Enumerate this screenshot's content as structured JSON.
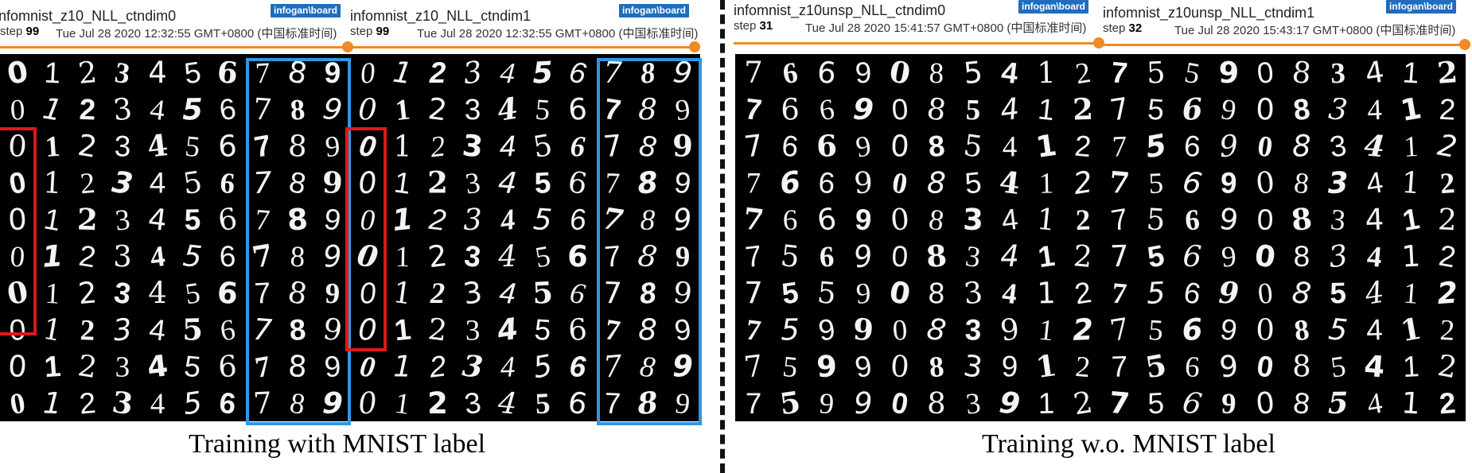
{
  "panels": [
    {
      "title": "nfomnist_z10_NLL_ctndim0",
      "badge": "infogan\\board",
      "step_label": "step",
      "step": "99",
      "timestamp": "Tue Jul 28 2020 12:32:55 GMT+0800 (中国标准时间)"
    },
    {
      "title": "infomnist_z10_NLL_ctndim1",
      "badge": "infogan\\board",
      "step_label": "step",
      "step": "99",
      "timestamp": "Tue Jul 28 2020 12:32:55 GMT+0800 (中国标准时间)"
    },
    {
      "title": "infomnist_z10unsp_NLL_ctndim0",
      "badge": "infogan\\board",
      "step_label": "step",
      "step": "31",
      "timestamp": "Tue Jul 28 2020 15:41:57 GMT+0800 (中国标准时间)"
    },
    {
      "title": "infomnist_z10unsp_NLL_ctndim1",
      "badge": "infogan\\board",
      "step_label": "step",
      "step": "32",
      "timestamp": "Tue Jul 28 2020 15:43:17 GMT+0800 (中国标准时间)"
    }
  ],
  "grids": [
    {
      "rows": [
        "0123456789",
        "0123456789",
        "0123456789",
        "0123456789",
        "0123456789",
        "0123456789",
        "0123456789",
        "0123456789",
        "0123456789",
        "0123456789"
      ]
    },
    {
      "rows": [
        "0123456789",
        "0123456789",
        "0123456789",
        "0123456789",
        "0123456789",
        "0123456789",
        "0123456789",
        "0123456789",
        "0123456789",
        "0123456789"
      ]
    },
    {
      "rows": [
        "7669085412",
        "7669085412",
        "7669085412",
        "7669085412",
        "7669083412",
        "7569083412",
        "7559083412",
        "7599083912",
        "7599083912",
        "7599083912"
      ]
    },
    {
      "rows": [
        "7559083412",
        "7569083412",
        "7569083412",
        "7569083412",
        "7569083412",
        "7569083412",
        "7569085412",
        "7569085412",
        "7569085412",
        "7569085412"
      ]
    }
  ],
  "captions": {
    "left": "Training with MNIST label",
    "right": "Training w.o. MNIST label"
  },
  "colors": {
    "accent": "#f08a24",
    "badge": "#1f6dbd",
    "highlight_red": "#e01818",
    "highlight_blue": "#2f98e6"
  }
}
